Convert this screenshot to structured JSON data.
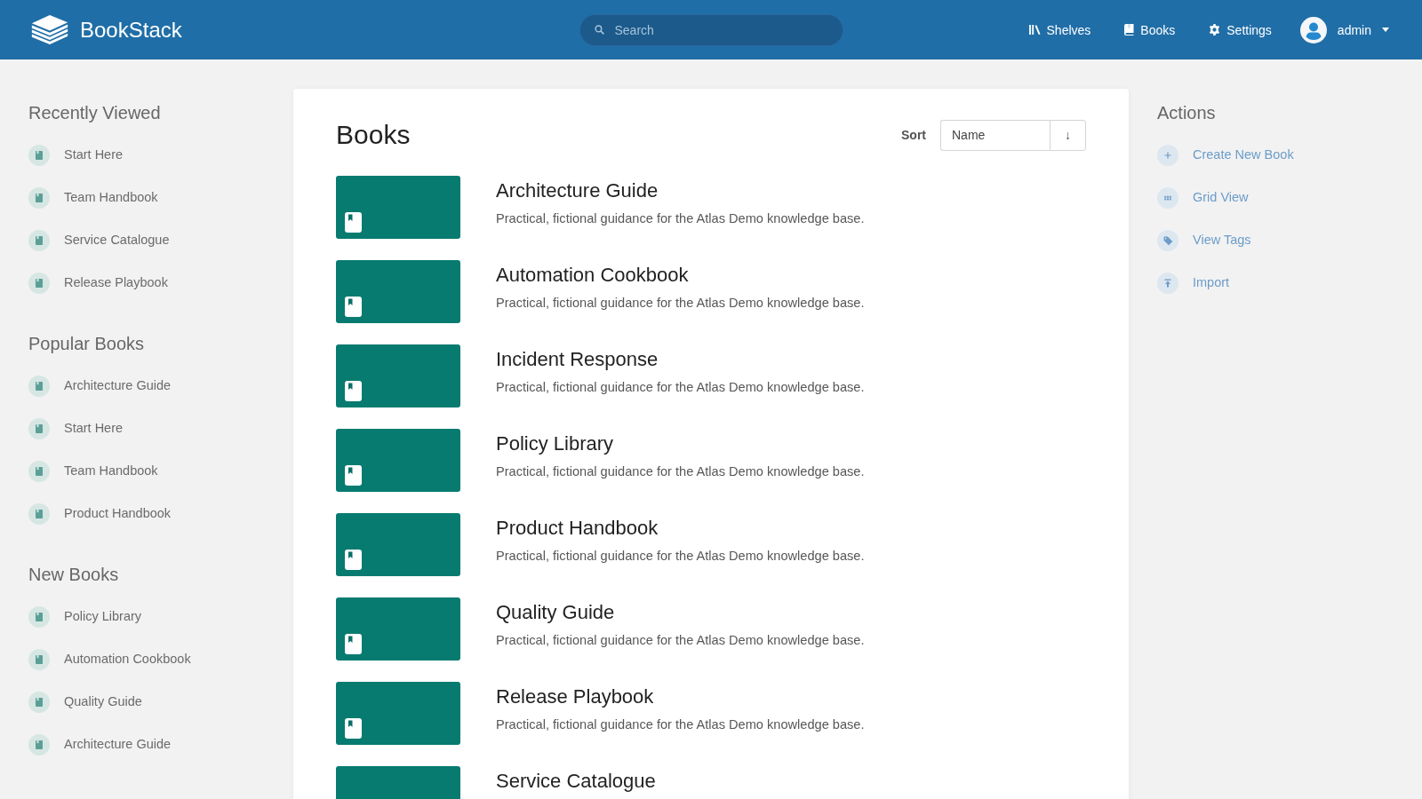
{
  "header": {
    "logo_text": "BookStack",
    "search": {
      "placeholder": "Search"
    },
    "nav": [
      {
        "kind": "shelves",
        "label": "Shelves"
      },
      {
        "kind": "books",
        "label": "Books"
      },
      {
        "kind": "settings",
        "label": "Settings"
      }
    ],
    "user": {
      "name": "admin"
    }
  },
  "sidebar": {
    "sections": [
      {
        "title": "Recently Viewed",
        "items": [
          "Start Here",
          "Team Handbook",
          "Service Catalogue",
          "Release Playbook"
        ]
      },
      {
        "title": "Popular Books",
        "items": [
          "Architecture Guide",
          "Start Here",
          "Team Handbook",
          "Product Handbook"
        ]
      },
      {
        "title": "New Books",
        "items": [
          "Policy Library",
          "Automation Cookbook",
          "Quality Guide",
          "Architecture Guide"
        ]
      }
    ]
  },
  "main": {
    "title": "Books",
    "sort": {
      "label": "Sort",
      "value": "Name",
      "direction": "↓"
    },
    "books": [
      {
        "title": "Architecture Guide",
        "description": "Practical, fictional guidance for the Atlas Demo knowledge base."
      },
      {
        "title": "Automation Cookbook",
        "description": "Practical, fictional guidance for the Atlas Demo knowledge base."
      },
      {
        "title": "Incident Response",
        "description": "Practical, fictional guidance for the Atlas Demo knowledge base."
      },
      {
        "title": "Policy Library",
        "description": "Practical, fictional guidance for the Atlas Demo knowledge base."
      },
      {
        "title": "Product Handbook",
        "description": "Practical, fictional guidance for the Atlas Demo knowledge base."
      },
      {
        "title": "Quality Guide",
        "description": "Practical, fictional guidance for the Atlas Demo knowledge base."
      },
      {
        "title": "Release Playbook",
        "description": "Practical, fictional guidance for the Atlas Demo knowledge base."
      },
      {
        "title": "Service Catalogue"
      }
    ]
  },
  "actions": {
    "title": "Actions",
    "items": [
      {
        "kind": "create",
        "label": "Create New Book"
      },
      {
        "kind": "grid",
        "label": "Grid View"
      },
      {
        "kind": "tags",
        "label": "View Tags"
      },
      {
        "kind": "import",
        "label": "Import"
      }
    ]
  }
}
